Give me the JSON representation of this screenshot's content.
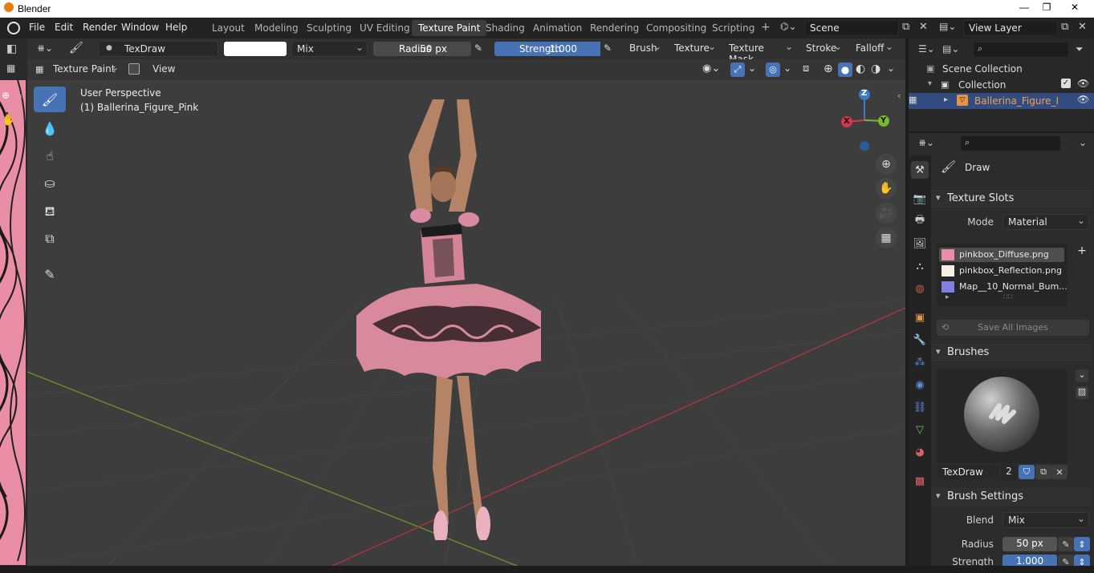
{
  "window": {
    "title": "Blender",
    "min": "—",
    "max": "❐",
    "close": "✕"
  },
  "menus": [
    "File",
    "Edit",
    "Render",
    "Window",
    "Help"
  ],
  "workspaces": [
    "Layout",
    "Modeling",
    "Sculpting",
    "UV Editing",
    "Texture Paint",
    "Shading",
    "Animation",
    "Rendering",
    "Compositing",
    "Scripting"
  ],
  "active_workspace": "Texture Paint",
  "add_tab": "+",
  "scene": {
    "name": "Scene",
    "view_layer": "View Layer"
  },
  "toolheader": {
    "brush_name": "TexDraw",
    "blend": "Mix",
    "radius_label": "Radius",
    "radius_value": "50 px",
    "strength_label": "Strength",
    "strength_value": "1.000",
    "strength_fraction": 1.0,
    "menus": [
      "Brush",
      "Texture",
      "Texture Mask",
      "Stroke",
      "Falloff"
    ]
  },
  "viewport": {
    "mode": "Texture Paint",
    "view_menu": "View",
    "perspective": "User Perspective",
    "object": "(1) Ballerina_Figure_Pink"
  },
  "gizmo": {
    "x": "X",
    "y": "Y",
    "z": "Z"
  },
  "outliner": {
    "root": "Scene Collection",
    "collection": "Collection",
    "object": "Ballerina_Figure_Pink"
  },
  "properties": {
    "tool_name": "Draw",
    "texture_slots": {
      "title": "Texture Slots",
      "mode_label": "Mode",
      "mode_value": "Material",
      "slots": [
        "pinkbox_Diffuse.png",
        "pinkbox_Reflection.png",
        "Map__10_Normal_Bum..."
      ],
      "save_all": "Save All Images"
    },
    "brushes": {
      "title": "Brushes",
      "name": "TexDraw",
      "users": "2"
    },
    "brush_settings": {
      "title": "Brush Settings",
      "blend_label": "Blend",
      "blend_value": "Mix",
      "radius_label": "Radius",
      "radius_value": "50 px",
      "strength_label": "Strength",
      "strength_value": "1.000"
    }
  },
  "colors": {
    "accent": "#4772b3",
    "pink": "#e98ea4",
    "active_object": "#f0a050"
  }
}
